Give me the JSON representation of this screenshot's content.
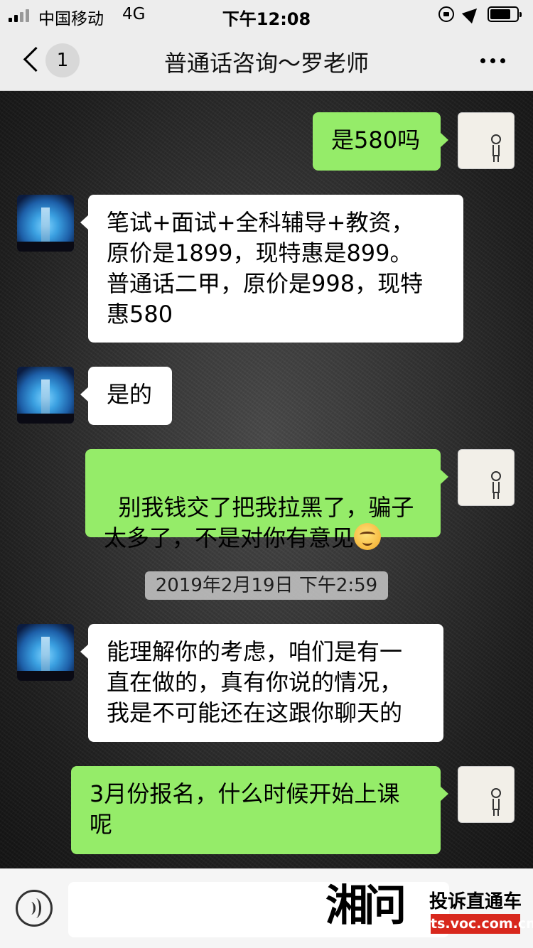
{
  "status_bar": {
    "carrier": "中国移动",
    "network": "4G",
    "time": "下午12:08"
  },
  "nav": {
    "back_badge": "1",
    "title": "普通话咨询～罗老师"
  },
  "messages": [
    {
      "side": "right",
      "text": "是580吗"
    },
    {
      "side": "left",
      "text": "笔试+面试+全科辅导+教资，\n原价是1899，现特惠是899。\n普通话二甲，原价是998，现特\n惠580"
    },
    {
      "side": "left",
      "text": "是的"
    },
    {
      "side": "right",
      "text": "别我钱交了把我拉黑了，骗子\n太多了，不是对你有意见",
      "emoji": "smiling-face"
    },
    {
      "side": "left",
      "text": "能理解你的考虑，咱们是有一\n直在做的，真有你说的情况，\n我是不可能还在这跟你聊天的"
    },
    {
      "side": "right",
      "text": "3月份报名，什么时候开始上课\n呢"
    }
  ],
  "timestamp": "2019年2月19日 下午2:59",
  "input_bar": {
    "value": ""
  },
  "watermark": {
    "logo": "湘问",
    "title": "投诉直通车",
    "url": "ts.voc.com.cn"
  },
  "colors": {
    "self_bubble": "#95ec69",
    "other_bubble": "#ffffff",
    "bar_bg": "#ededed",
    "watermark_red": "#d8281d"
  }
}
